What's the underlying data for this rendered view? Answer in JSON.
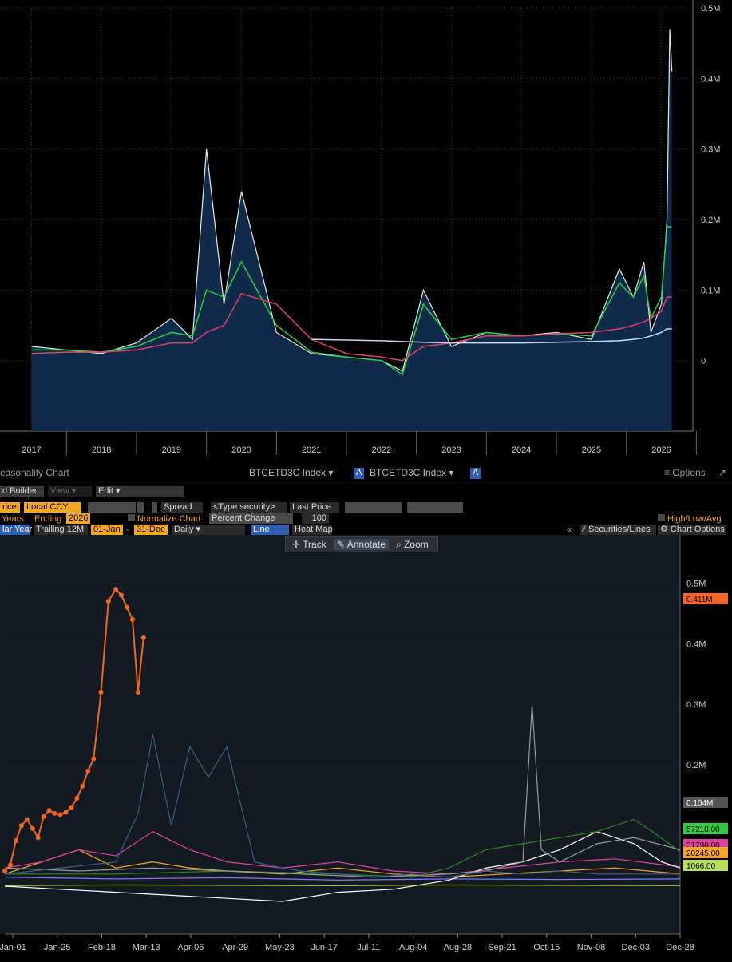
{
  "top_chart": {
    "y_ticks": [
      "0.5M",
      "0.4M",
      "0.3M",
      "0.2M",
      "0.1M",
      "0"
    ],
    "x_ticks": [
      "2017",
      "2018",
      "2019",
      "2020",
      "2021",
      "2022",
      "2023",
      "2024",
      "2025",
      "2026"
    ]
  },
  "toolbar": {
    "title": "easonality Chart",
    "security1": "BTCETD3C Index",
    "security2": "BTCETD3C Index",
    "badge": "A",
    "options": "≡ Options",
    "builder": "d Builder",
    "view": "View ▾",
    "edit": "Edit ▾",
    "price": "rice",
    "ccy": "Local CCY",
    "spread": "Spread",
    "type_security": "<Type security>",
    "last_price": "Last Price",
    "years": "Years",
    "ending": "Ending",
    "ending_year": "2026",
    "normalize": "Normalize Chart",
    "percent_change": "Percent Change",
    "hundred": "100",
    "hla": "High/Low/Avg",
    "lar_year": "lar Year",
    "trailing": "Trailing 12M",
    "start": "01-Jan",
    "end": "31-Dec",
    "daily": "Daily",
    "line": "Line",
    "heat_map": "Heat Map",
    "securities_lines": "Securities/Lines",
    "chart_options": "Chart Options",
    "collapse": "«",
    "track": "Track",
    "annotate": "Annotate",
    "zoom": "Zoom"
  },
  "chart_data": [
    {
      "type": "area",
      "title": "",
      "x": [
        2017.0,
        2017.5,
        2018.0,
        2018.5,
        2019.0,
        2019.3,
        2019.5,
        2019.75,
        2020.0,
        2020.5,
        2021.0,
        2021.5,
        2022.0,
        2022.3,
        2022.6,
        2023.0,
        2023.5,
        2024.0,
        2024.5,
        2025.0,
        2025.4,
        2025.6,
        2025.75,
        2025.85,
        2026.0,
        2026.08,
        2026.12,
        2026.15
      ],
      "series": [
        {
          "color": "#e8e8e8",
          "values": [
            20000,
            15000,
            10000,
            25000,
            60000,
            30000,
            300000,
            80000,
            240000,
            40000,
            10000,
            5000,
            0,
            -15000,
            100000,
            20000,
            40000,
            35000,
            40000,
            30000,
            130000,
            90000,
            140000,
            40000,
            80000,
            200000,
            470000,
            410000
          ]
        },
        {
          "color": "#2ecc40",
          "values": [
            15000,
            15000,
            12000,
            20000,
            40000,
            35000,
            100000,
            90000,
            140000,
            50000,
            12000,
            5000,
            0,
            -20000,
            80000,
            30000,
            40000,
            35000,
            38000,
            35000,
            110000,
            90000,
            120000,
            60000,
            90000,
            190000,
            190000,
            190000
          ]
        },
        {
          "color": "#e0406a",
          "values": [
            10000,
            12000,
            12000,
            15000,
            25000,
            25000,
            40000,
            50000,
            95000,
            80000,
            30000,
            10000,
            5000,
            0,
            20000,
            25000,
            35000,
            35000,
            38000,
            40000,
            45000,
            50000,
            55000,
            60000,
            70000,
            90000,
            90000,
            90000
          ]
        },
        {
          "color": "#c8d8f0",
          "values": [
            null,
            null,
            null,
            null,
            null,
            null,
            null,
            null,
            null,
            null,
            30000,
            29000,
            28000,
            27000,
            26000,
            25000,
            25000,
            25000,
            26000,
            27000,
            28000,
            30000,
            32000,
            35000,
            40000,
            45000,
            45000,
            45000
          ]
        }
      ],
      "ylim": [
        -100000,
        500000
      ]
    },
    {
      "type": "line",
      "title": "Seasonality Chart",
      "categories": [
        "Jan-01",
        "Jan-25",
        "Feb-18",
        "Mar-13",
        "Apr-06",
        "Apr-29",
        "May-23",
        "Jun-17",
        "Jul-11",
        "Aug-04",
        "Aug-28",
        "Sep-21",
        "Oct-15",
        "Nov-08",
        "Dec-03",
        "Dec-28"
      ],
      "y_ticks": [
        "0.5M",
        "0.4M",
        "0.3M",
        "0.2M"
      ],
      "ylim": [
        0,
        540000
      ],
      "last_value_labels": [
        {
          "text": "0.411M",
          "color": "#f26522"
        },
        {
          "text": "0.104M",
          "color": "#555555"
        },
        {
          "text": "57218.00",
          "color": "#2ecc40"
        },
        {
          "text": "31790.00",
          "color": "#e040a0"
        },
        {
          "text": "20245.00",
          "color": "#f5a623"
        },
        {
          "text": "1066.00",
          "color": "#b8e05a"
        }
      ],
      "series": [
        {
          "color": "#f26522",
          "x": [
            0,
            3,
            6,
            9,
            12,
            15,
            18,
            21,
            24,
            27,
            30,
            33,
            36,
            39,
            42,
            45,
            48,
            52,
            56,
            60,
            63,
            66,
            69,
            72,
            75,
            78,
            80,
            83,
            86,
            89,
            92,
            94
          ],
          "values": [
            25000,
            35000,
            75000,
            100000,
            110000,
            95000,
            80000,
            115000,
            125000,
            120000,
            118000,
            122000,
            130000,
            145000,
            165000,
            190000,
            210000,
            320000,
            470000,
            490000,
            480000,
            460000,
            440000,
            320000,
            410000,
            null,
            null,
            null,
            null,
            null,
            null,
            null
          ]
        },
        {
          "color": "#3b5e8a",
          "x": [
            0,
            30,
            60,
            72,
            80,
            90,
            100,
            110,
            120,
            135,
            150,
            160,
            180,
            200,
            220,
            240,
            260,
            280,
            300,
            320,
            340,
            365
          ],
          "values": [
            20000,
            30000,
            40000,
            120000,
            250000,
            100000,
            230000,
            180000,
            230000,
            40000,
            30000,
            25000,
            20000,
            15000,
            20000,
            15000,
            25000,
            20000,
            25000,
            20000,
            20000,
            20000
          ]
        },
        {
          "color": "#9a9a9a",
          "x": [
            0,
            40,
            80,
            120,
            160,
            200,
            240,
            260,
            280,
            285,
            290,
            300,
            320,
            340,
            365
          ],
          "values": [
            30000,
            25000,
            30000,
            25000,
            20000,
            15000,
            20000,
            25000,
            40000,
            300000,
            60000,
            40000,
            70000,
            80000,
            60000
          ]
        },
        {
          "color": "#2a8a2a",
          "x": [
            0,
            60,
            120,
            180,
            220,
            240,
            260,
            280,
            300,
            320,
            340,
            350,
            365
          ],
          "values": [
            20000,
            20000,
            25000,
            20000,
            15000,
            30000,
            60000,
            70000,
            80000,
            90000,
            110000,
            90000,
            57000
          ]
        },
        {
          "color": "#ffffff",
          "x": [
            0,
            30,
            60,
            90,
            120,
            150,
            180,
            210,
            240,
            260,
            280,
            300,
            320,
            340,
            355,
            365
          ],
          "values": [
            0,
            -5000,
            -10000,
            -15000,
            -20000,
            -25000,
            -10000,
            -5000,
            10000,
            30000,
            40000,
            60000,
            90000,
            70000,
            40000,
            30000
          ]
        },
        {
          "color": "#e040a0",
          "x": [
            0,
            20,
            40,
            60,
            80,
            100,
            120,
            150,
            180,
            210,
            240,
            270,
            300,
            330,
            365
          ],
          "values": [
            30000,
            40000,
            60000,
            50000,
            90000,
            60000,
            40000,
            30000,
            40000,
            25000,
            20000,
            30000,
            40000,
            45000,
            31790
          ]
        },
        {
          "color": "#f5a623",
          "x": [
            0,
            20,
            40,
            60,
            80,
            100,
            120,
            150,
            180,
            210,
            240,
            270,
            300,
            330,
            365
          ],
          "values": [
            20000,
            40000,
            60000,
            30000,
            40000,
            30000,
            25000,
            20000,
            30000,
            20000,
            15000,
            20000,
            25000,
            30000,
            20245
          ]
        },
        {
          "color": "#b8e05a",
          "x": [
            0,
            60,
            120,
            180,
            240,
            300,
            365
          ],
          "values": [
            1000,
            2000,
            1500,
            1000,
            2000,
            1500,
            1066
          ]
        },
        {
          "color": "#7a7aff",
          "x": [
            0,
            60,
            120,
            180,
            240,
            300,
            365
          ],
          "values": [
            15000,
            12000,
            14000,
            10000,
            12000,
            11000,
            12000
          ]
        }
      ]
    }
  ]
}
